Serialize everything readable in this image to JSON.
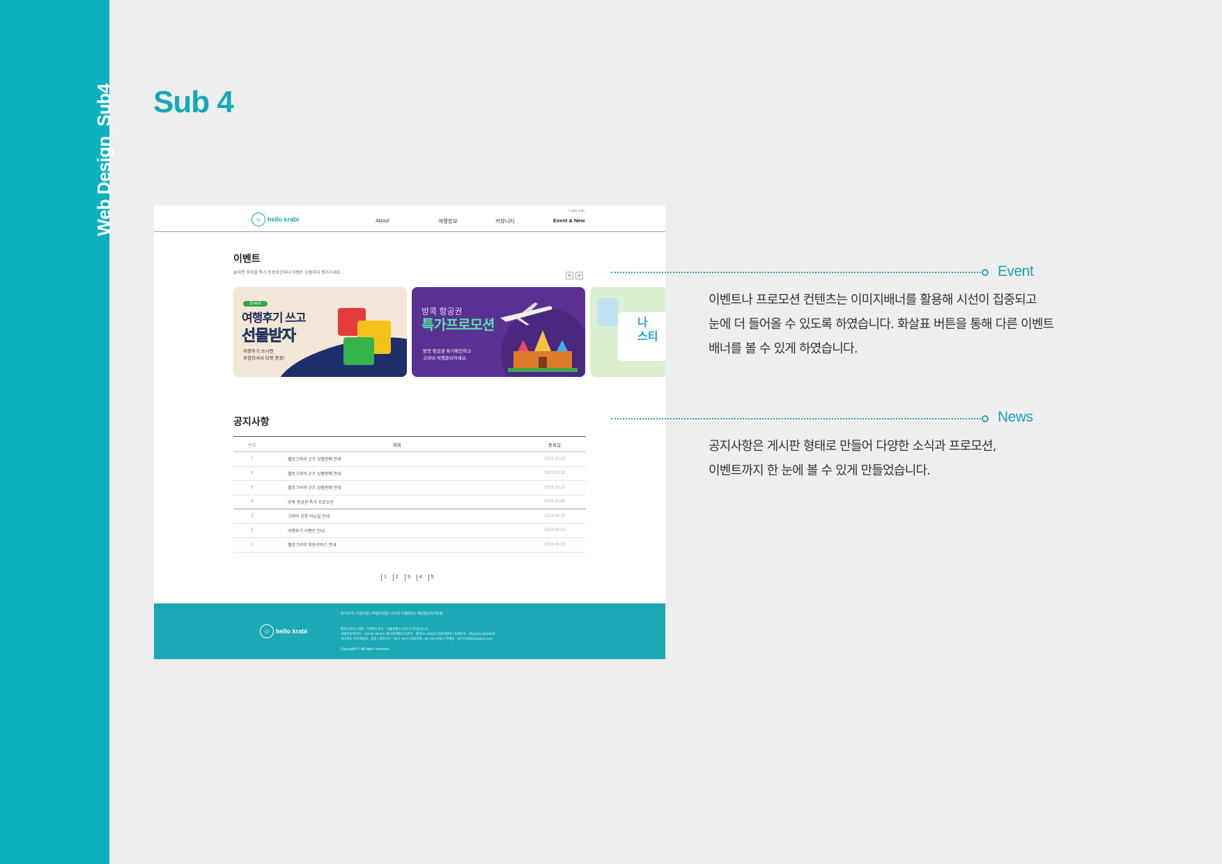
{
  "sidebar": {
    "label": "Web Design_Sub4"
  },
  "page_title": "Sub 4",
  "mock": {
    "logo_text": "hello krabi",
    "logo_mark": "☺",
    "util_links": "Login  Join",
    "nav": [
      "About",
      "여행정보",
      "커뮤니티",
      "Event & New"
    ],
    "event_section": {
      "title": "이벤트",
      "desc": "놓치면 후회할 특가 프로모션부터 이벤트 상품까지 챙겨가세요.",
      "prev_arrow": "<",
      "next_arrow": ">",
      "banners": [
        {
          "tag": "Event",
          "head1": "여행후기 쓰고",
          "head2": "선물받자",
          "sub": "여행후기 쓰시면\n추첨하셔서 티켓 증정!"
        },
        {
          "head1": "방콕 항공권",
          "head2": "특가프로모션",
          "sub": "방콕 항공권 특가확인하고\n고라비 여행준비하세요."
        },
        {
          "text": "나\n스티"
        }
      ]
    },
    "notice_section": {
      "title": "공지사항",
      "columns": [
        "번호",
        "제목",
        "등록일"
      ],
      "rows": [
        {
          "no": "7",
          "title": "헬로크라비 굿즈 상품판매 안내",
          "date": "2023.10.12"
        },
        {
          "no": "6",
          "title": "헬로크라비 굿즈 상품판매 안내",
          "date": "2023.10.12"
        },
        {
          "no": "5",
          "title": "헬로크라비 굿즈 상품판매 안내",
          "date": "2023.10.12"
        },
        {
          "no": "4",
          "title": "방콕 항공권 특가 프로모션",
          "date": "2023.10.05"
        },
        {
          "no": "3",
          "title": "크라비 공항 리뉴얼 안내",
          "date": "2023.04.22"
        },
        {
          "no": "2",
          "title": "여행후기 이벤트 안내",
          "date": "2022.08.10"
        },
        {
          "no": "1",
          "title": "헬로크라비 회원서비스 안내",
          "date": "2022.08.05"
        }
      ],
      "pages": [
        "1",
        "2",
        "3",
        "4",
        "5"
      ]
    },
    "footer": {
      "links": "회사소개  |  이용약관  |  여행자보험  |  사이트 이용안내  |  개인정보처리방침",
      "info": "헬로크라비  |  대표 : 기여여  |  주소 : 서울특별시 종로구 마치는동 41\n사업자등록번호 : 102-81-35440  |  통신판매업신고번호 : 종로01-1606호 관광사업자  |  등록번호 : 제11003-000006호\n개인정보 보호책임자 : 홍길  |  영업시간 : 09시-18시  |  대표전화 : 02-734-0392  |  이메일 : 1577123@hanatour.com",
      "copyright": "Copyright ©. All rights reserved."
    }
  },
  "callouts": [
    {
      "label": "Event",
      "text": "이벤트나 프로모션 컨텐츠는 이미지배너를 활용해 시선이 집중되고\n눈에 더 들어올 수 있도록 하였습니다. 화살표 버튼을 통해 다른 이벤트\n배너를 볼 수 있게 하였습니다."
    },
    {
      "label": "News",
      "text": "공지사항은 게시판 형태로 만들어 다양한 소식과 프로모션,\n이벤트까지 한 눈에 볼  수 있게 만들었습니다."
    }
  ],
  "colors": {
    "accent": "#0bb1bd",
    "title": "#14a8b7",
    "background": "#eeeeee"
  }
}
